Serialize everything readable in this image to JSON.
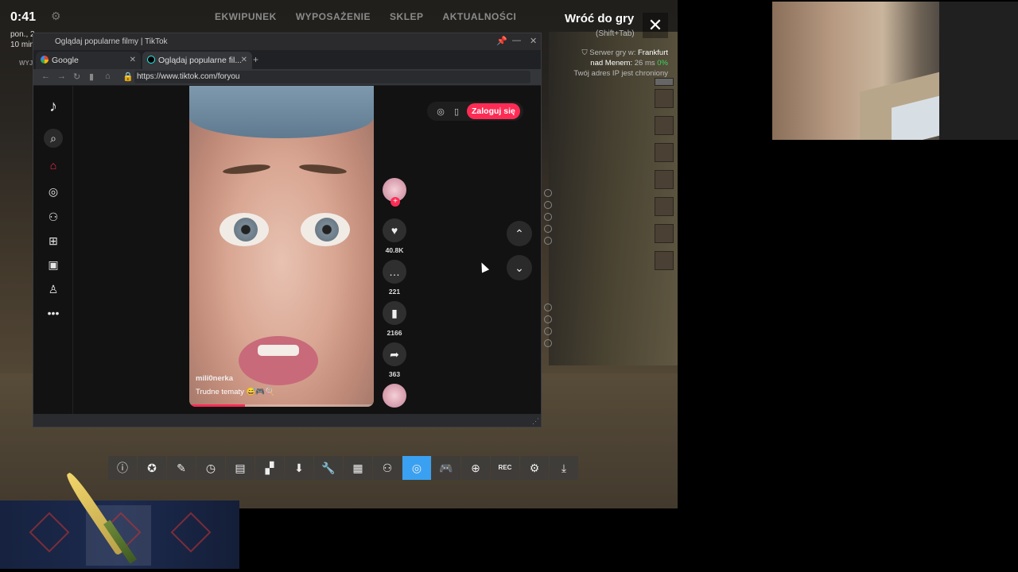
{
  "hud": {
    "clock": "0:41",
    "date_line1": "pon., 2",
    "date_line2": "10 min",
    "nav": [
      "EKWIPUNEK",
      "WYPOSAŻENIE",
      "SKLEP",
      "AKTUALNOŚCI"
    ],
    "left_label": "WYJ",
    "back_title": "Wróć do gry",
    "back_shortcut": "(Shift+Tab)",
    "close_symbol": "✕",
    "server_prefix": "Serwer gry w:",
    "server_city": "Frankfurt",
    "latency_label": "nad Menem:",
    "latency_value": "26 ms",
    "loss_value": "0%",
    "ip_note": "Twój adres IP jest chroniony"
  },
  "browser": {
    "window_title": "Oglądaj popularne filmy | TikTok",
    "tabs": [
      {
        "label": "Google",
        "icon": "google-icon"
      },
      {
        "label": "Oglądaj popularne fil...",
        "icon": "tiktok-icon"
      }
    ],
    "new_tab_symbol": "+",
    "url": "https://www.tiktok.com/foryou"
  },
  "tiktok": {
    "login_label": "Zaloguj się",
    "video_user": "mili0nerka",
    "video_caption": "Trudne tematy 😅🎮🍭",
    "progress": 0.3,
    "likes": "40.8K",
    "comments": "221",
    "saves": "2166",
    "shares": "363"
  },
  "colors": {
    "accent": "#fe2c55",
    "toolbar_active": "#3aa1f2",
    "status_green": "#3fd55b"
  },
  "toolbar": {
    "rec_label": "REC",
    "active_index": 10
  }
}
